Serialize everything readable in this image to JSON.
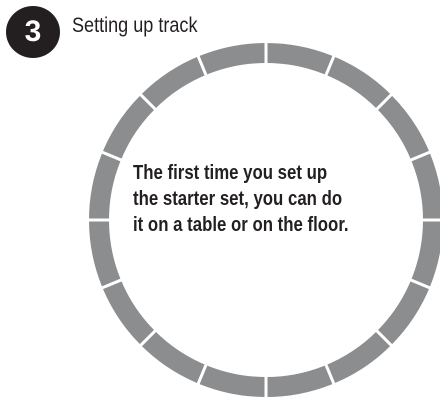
{
  "step": {
    "number": "3",
    "title": "Setting up track"
  },
  "caption": {
    "lines": [
      "The first time you set up",
      "the starter set, you can do",
      "it on a table or on the floor."
    ]
  },
  "track": {
    "segments": 16,
    "color": "#8c8d8f",
    "gap_color": "#ffffff",
    "icon": "circular-track-icon"
  }
}
